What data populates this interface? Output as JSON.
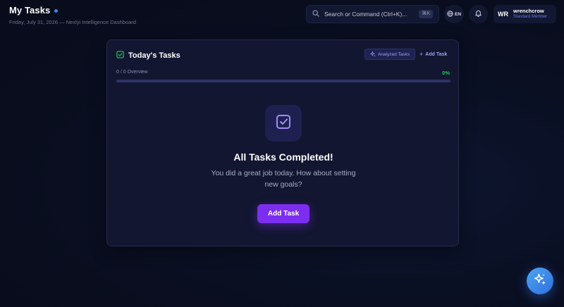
{
  "header": {
    "title": "My Tasks",
    "subtitle": "Friday, July 31, 2026 — Nexlyi Intelligence Dashboard"
  },
  "search": {
    "placeholder": "Search or Command (Ctrl+K)...",
    "shortcut": "⌘K",
    "icon": "search-icon"
  },
  "language": {
    "label": "EN",
    "icon": "globe-icon"
  },
  "notifications": {
    "icon": "bell-icon"
  },
  "user": {
    "initials": "WR",
    "name": "wrenchcrow",
    "role": "Standard Member"
  },
  "card": {
    "title": "Today's Tasks",
    "title_icon": "checkbox-icon",
    "analyzed_label": "Analyzed Tasks",
    "analyzed_icon": "sparkle-icon",
    "add_task_link": "Add Task",
    "progress_label": "0 / 0 Overview",
    "progress_percent": "0%",
    "progress_value": 0,
    "empty_state": {
      "icon": "checkbox-icon",
      "title": "All Tasks Completed!",
      "message": "You did a great job today. How about setting new goals?",
      "button_label": "Add Task"
    }
  },
  "fab": {
    "icon": "sparkle-icon"
  },
  "colors": {
    "accent": "#7c2ef0",
    "success": "#22c55e",
    "brand_blue": "#3b82f6",
    "background": "#0a0f22"
  }
}
